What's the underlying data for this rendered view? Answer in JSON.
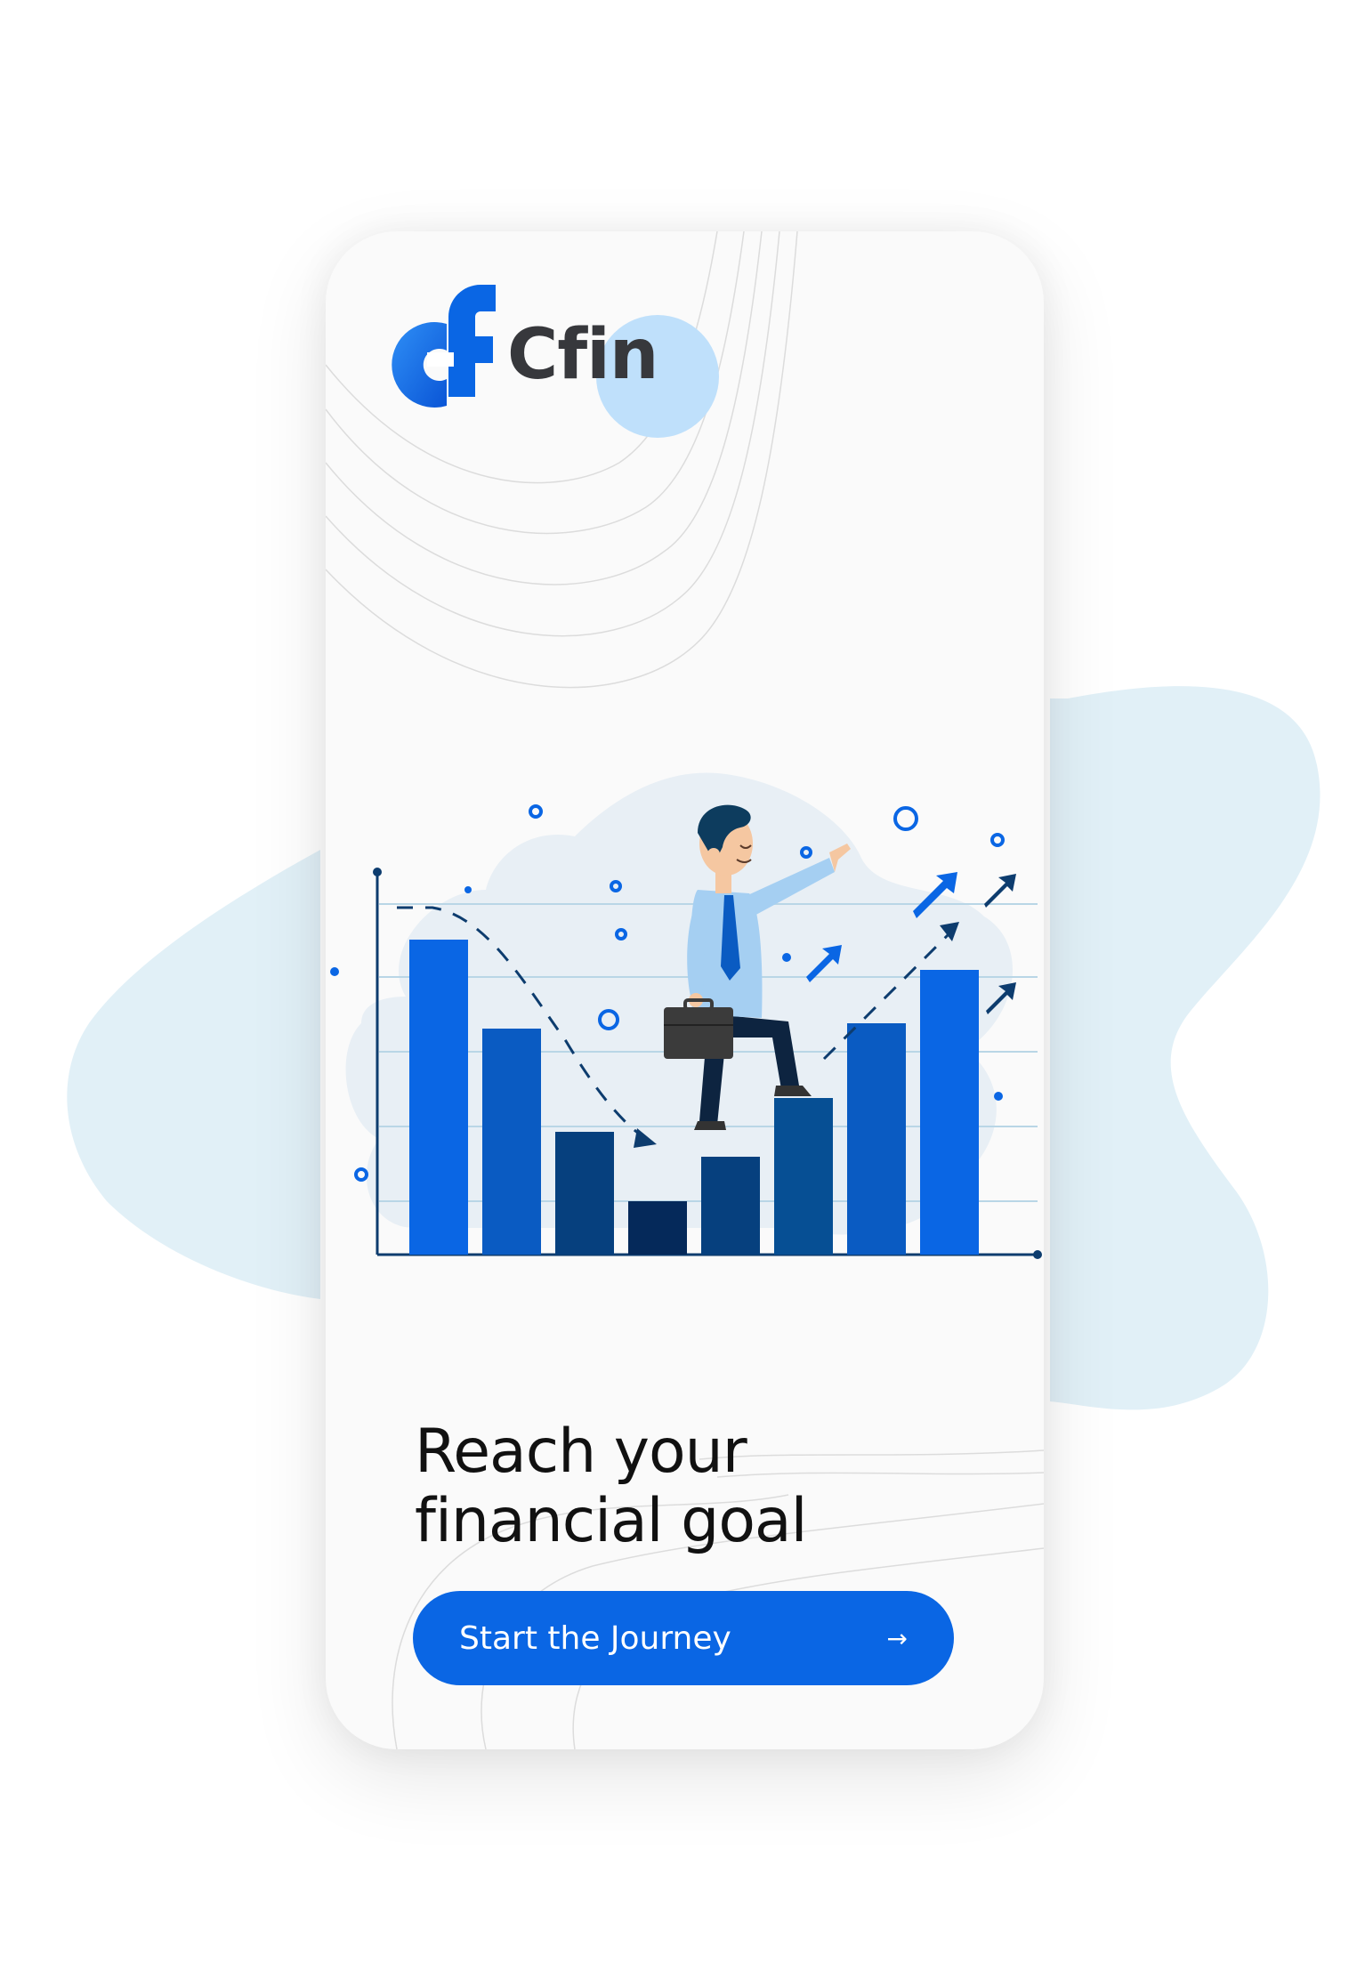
{
  "app": {
    "name": "Cfin"
  },
  "onboarding": {
    "headline_line1": "Reach your",
    "headline_line2": "financial goal",
    "cta_label": "Start the Journey",
    "cta_icon": "arrow-right-icon"
  },
  "colors": {
    "brand_blue": "#0a66e4",
    "logo_circle": "#bfe0fb",
    "blob": "#e1f0f7",
    "text_dark": "#37383c"
  }
}
